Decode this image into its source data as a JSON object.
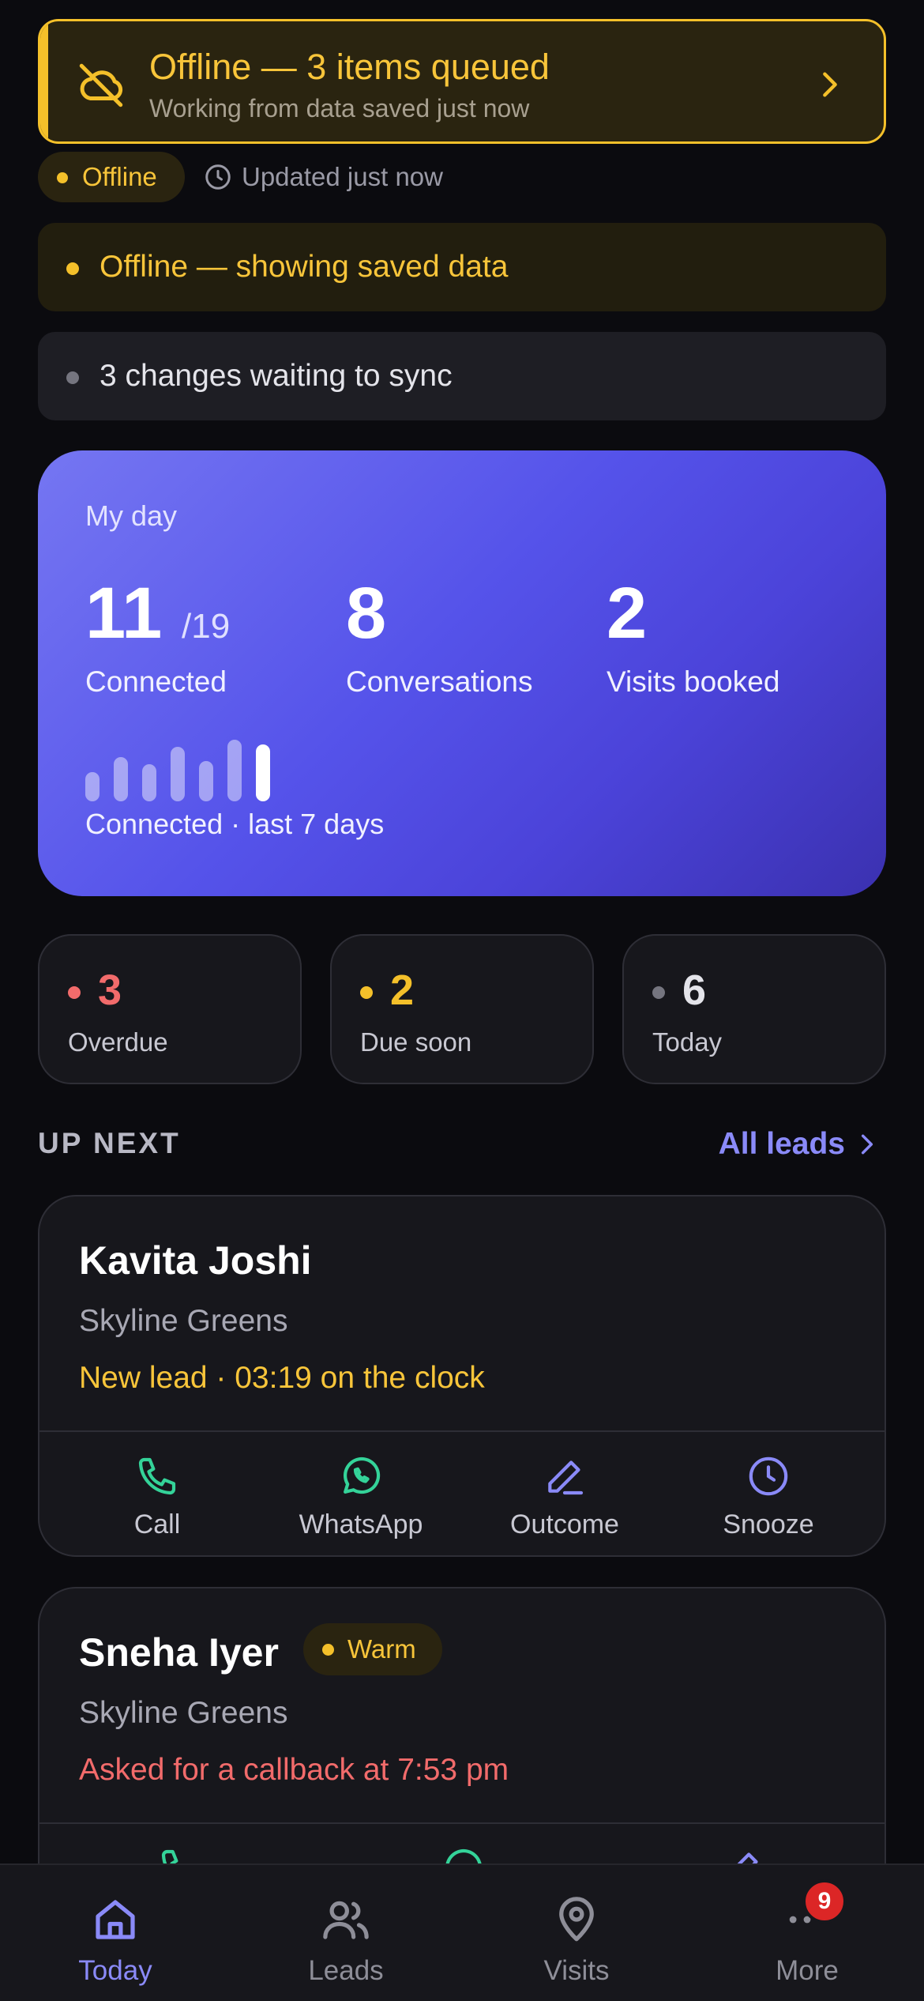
{
  "offline_banner": {
    "title": "Offline — 3 items queued",
    "subtitle": "Working from data saved just now",
    "accent": "#f4c02a"
  },
  "status_row": {
    "chip": "Offline",
    "updated": "Updated just now"
  },
  "notices": {
    "saved": "Offline — showing saved data",
    "sync": "3 changes waiting to sync"
  },
  "my_day": {
    "heading": "My day",
    "connected_value": "11",
    "connected_total": "/19",
    "connected_label": "Connected",
    "conversations_value": "8",
    "conversations_label": "Conversations",
    "visits_value": "2",
    "visits_label": "Visits booked",
    "sparkline_label": "Connected · last 7 days",
    "sparkline_levels": [
      0.48,
      0.72,
      0.6,
      0.88,
      0.66,
      1.0,
      0.92
    ]
  },
  "tiles": [
    {
      "value": "3",
      "label": "Overdue",
      "color": "#f26b6b"
    },
    {
      "value": "2",
      "label": "Due soon",
      "color": "#f4c02a"
    },
    {
      "value": "6",
      "label": "Today",
      "color": "#e4e4ea",
      "dot": "#75757f"
    }
  ],
  "up_next": {
    "heading": "UP NEXT",
    "all_link": "All leads"
  },
  "leads": [
    {
      "name": "Kavita Joshi",
      "project": "Skyline Greens",
      "status": "New lead · 03:19 on the clock",
      "status_color": "#f8c53a",
      "actions": [
        "Call",
        "WhatsApp",
        "Outcome",
        "Snooze"
      ]
    },
    {
      "name": "Sneha Iyer",
      "tag": "Warm",
      "project": "Skyline Greens",
      "status": "Asked for a callback at 7:53 pm",
      "status_color": "#f26b6b"
    }
  ],
  "nav": {
    "items": [
      "Today",
      "Leads",
      "Visits",
      "More"
    ],
    "active": "Today",
    "more_badge": "9"
  }
}
